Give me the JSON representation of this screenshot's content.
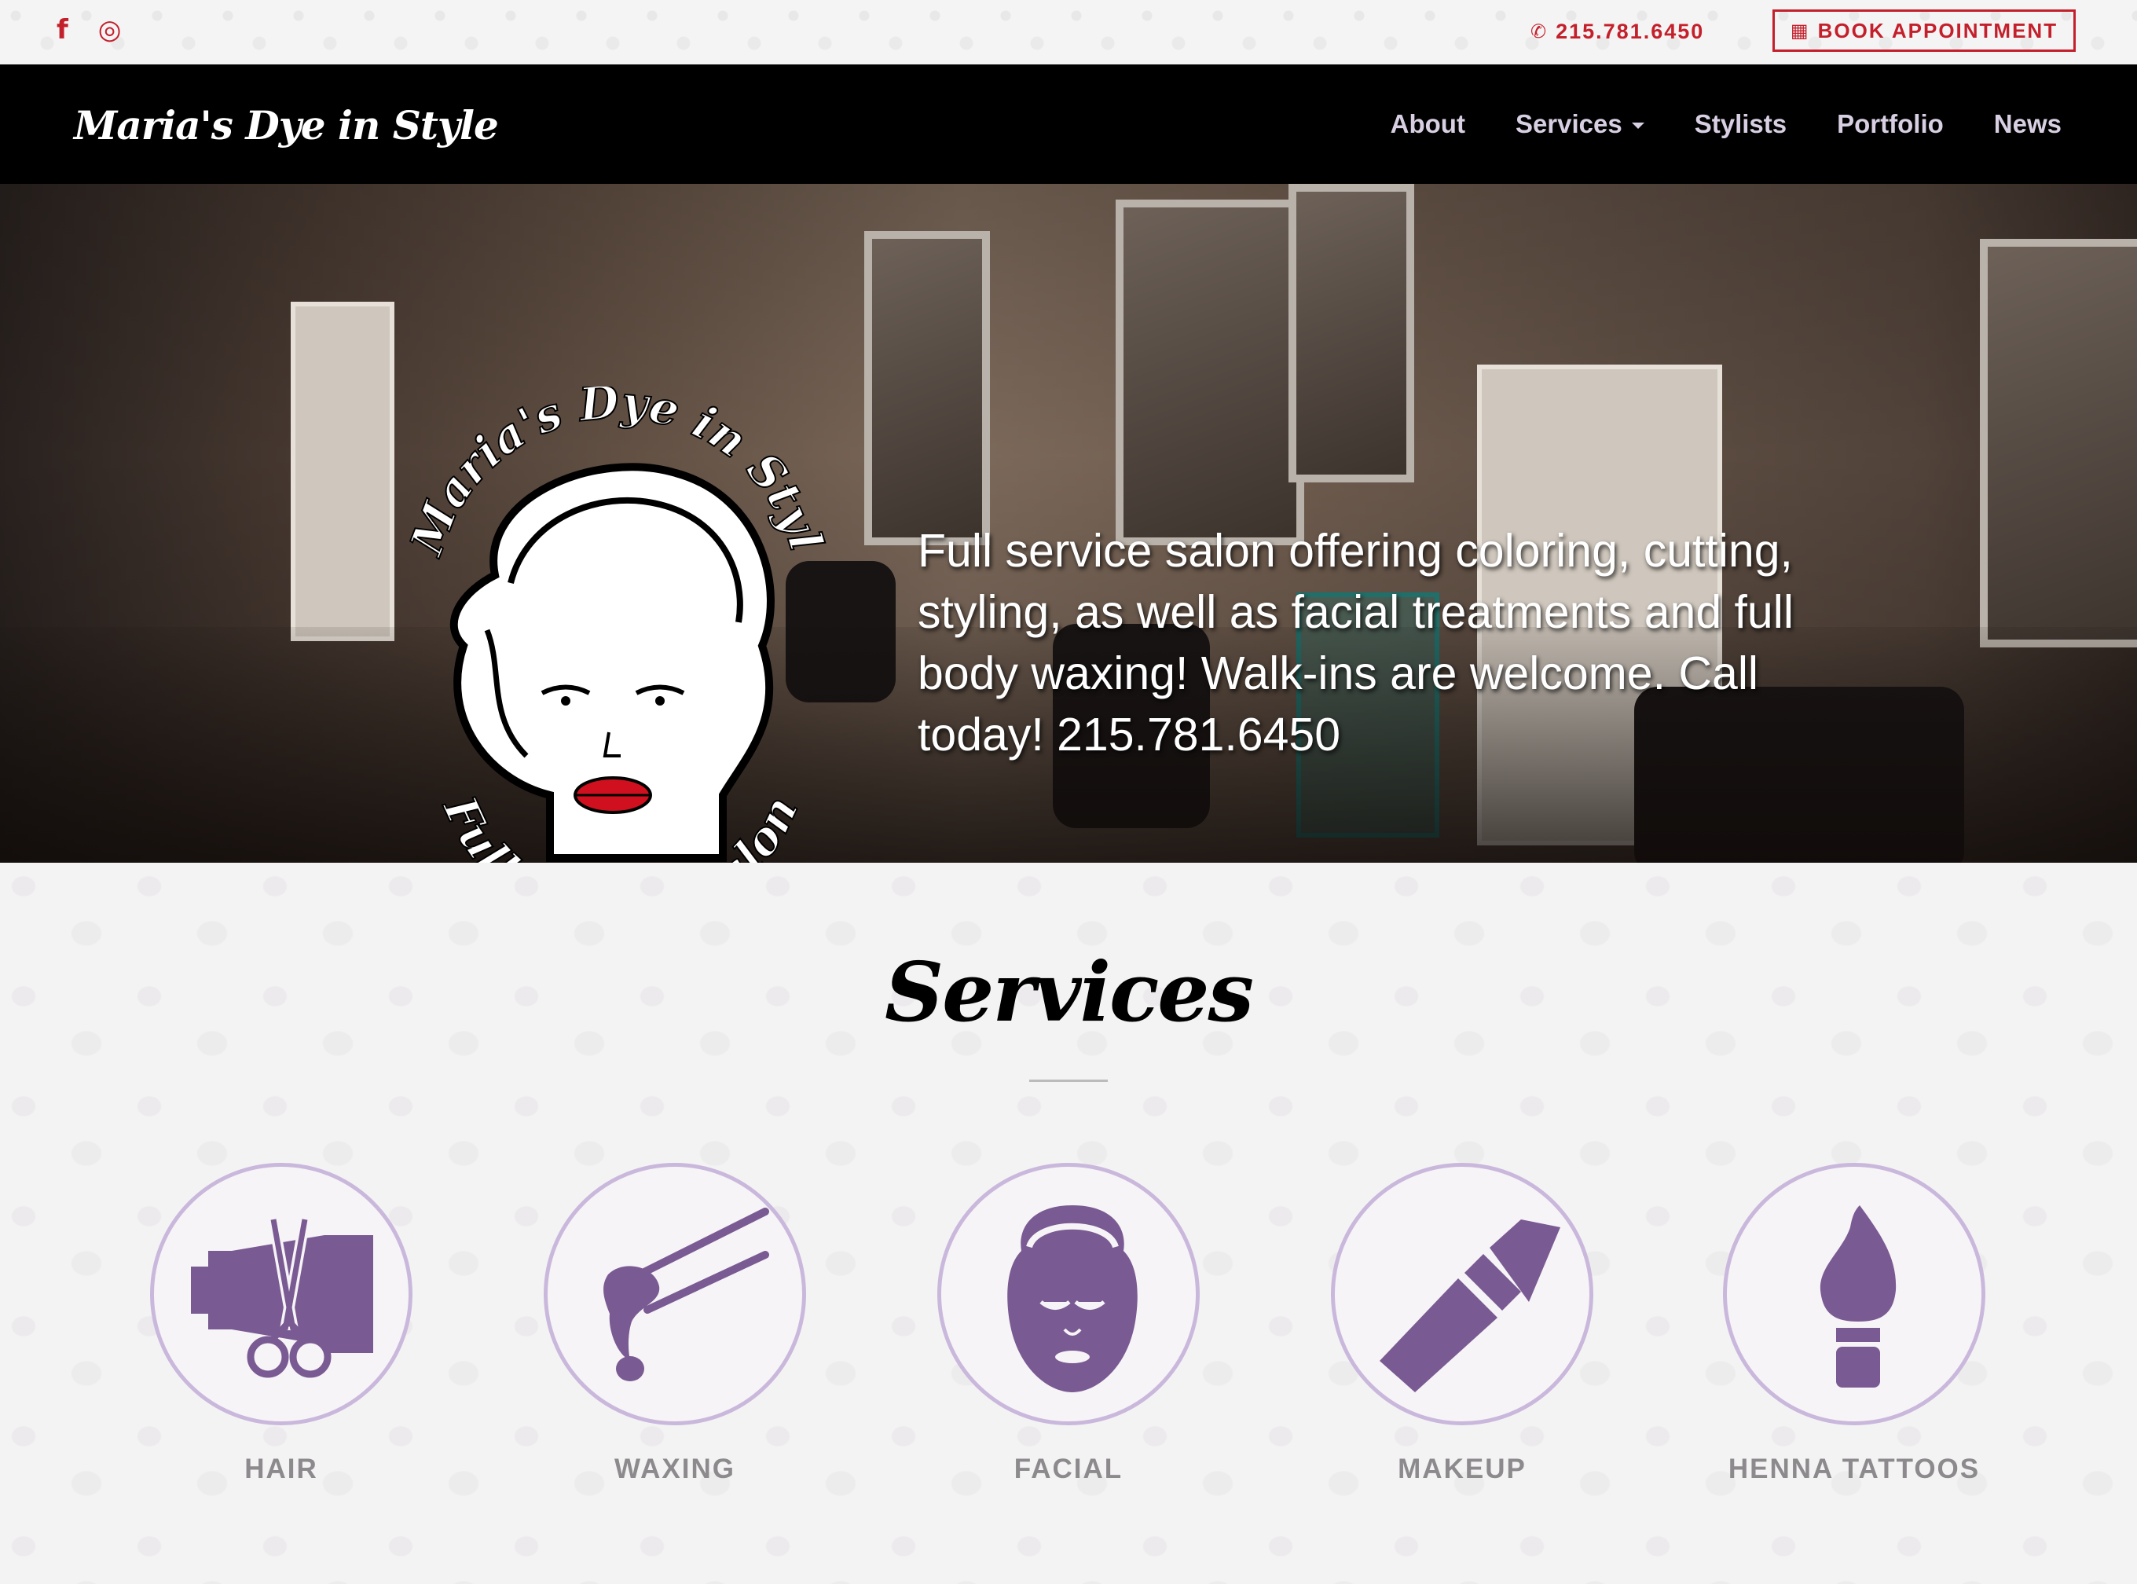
{
  "topbar": {
    "social_icons": [
      "facebook-icon",
      "instagram-icon"
    ],
    "social_glyphs": {
      "facebook": "f",
      "instagram": "◎"
    },
    "phone_icon": "phone-icon",
    "phone_glyph": "✆",
    "phone": "215.781.6450",
    "book_icon": "calendar-icon",
    "book_glyph": "▦",
    "book_label": "BOOK APPOINTMENT"
  },
  "nav": {
    "brand": "Maria's Dye in Style",
    "links": [
      {
        "label": "About"
      },
      {
        "label": "Services",
        "dropdown": true
      },
      {
        "label": "Stylists"
      },
      {
        "label": "Portfolio"
      },
      {
        "label": "News"
      }
    ]
  },
  "hero": {
    "logo": {
      "top_text": "Maria's Dye in Style",
      "bottom_text": "Full Service Salon"
    },
    "tagline": "Full service salon offering coloring, cutting, styling, as well as facial treatments and full body waxing! Walk-ins are welcome. Call today! 215.781.6450"
  },
  "services": {
    "title": "Services",
    "items": [
      {
        "label": "HAIR",
        "icon": "scissors-hairdryer-icon"
      },
      {
        "label": "WAXING",
        "icon": "wax-stick-icon"
      },
      {
        "label": "FACIAL",
        "icon": "face-mask-icon"
      },
      {
        "label": "MAKEUP",
        "icon": "lipstick-icon"
      },
      {
        "label": "HENNA TATTOOS",
        "icon": "paintbrush-icon"
      }
    ]
  },
  "colors": {
    "accent_red": "#c3202b",
    "icon_purple": "#7a5a92",
    "circle_border": "#c9b8dc",
    "nav_link": "#d8cfe3"
  }
}
